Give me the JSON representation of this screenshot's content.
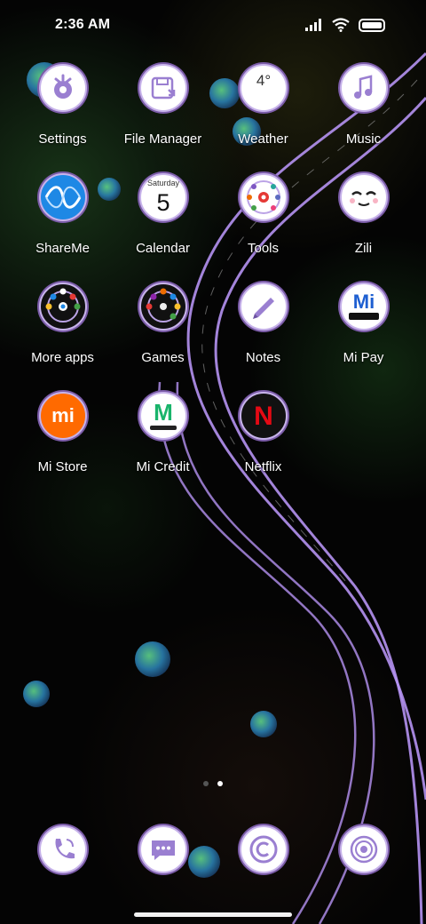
{
  "status_bar": {
    "time": "2:36 AM",
    "icons": [
      "signal-icon",
      "wifi-icon",
      "battery-icon"
    ]
  },
  "apps": [
    {
      "label": "Settings",
      "icon": "settings-icon"
    },
    {
      "label": "File Manager",
      "icon": "file-manager-icon"
    },
    {
      "label": "Weather",
      "icon": "weather-icon",
      "icon_text": "4°"
    },
    {
      "label": "Music",
      "icon": "music-icon"
    },
    {
      "label": "ShareMe",
      "icon": "shareme-icon"
    },
    {
      "label": "Calendar",
      "icon": "calendar-icon",
      "icon_day": "Saturday",
      "icon_date": "5"
    },
    {
      "label": "Tools",
      "icon": "tools-folder-icon"
    },
    {
      "label": "Zili",
      "icon": "zili-icon"
    },
    {
      "label": "More apps",
      "icon": "more-apps-folder-icon"
    },
    {
      "label": "Games",
      "icon": "games-folder-icon"
    },
    {
      "label": "Notes",
      "icon": "notes-icon"
    },
    {
      "label": "Mi Pay",
      "icon": "mi-pay-icon",
      "icon_text": "Mi"
    },
    {
      "label": "Mi Store",
      "icon": "mi-store-icon",
      "icon_text": "mi"
    },
    {
      "label": "Mi Credit",
      "icon": "mi-credit-icon",
      "icon_text": "M"
    },
    {
      "label": "Netflix",
      "icon": "netflix-icon",
      "icon_text": "N"
    }
  ],
  "page_indicator": {
    "pages": 2,
    "current": 2
  },
  "dock": [
    {
      "icon": "phone-icon"
    },
    {
      "icon": "messaging-icon"
    },
    {
      "icon": "browser-icon"
    },
    {
      "icon": "camera-icon"
    }
  ],
  "colors": {
    "icon_accent": "#9a7fd1",
    "ring": "#c7b3ea",
    "road_line": "#b592f2",
    "netflix_red": "#e50914",
    "mi_orange": "#ff6a00",
    "mi_credit_green": "#19b46b",
    "shareme_blue": "#1e88e5"
  }
}
